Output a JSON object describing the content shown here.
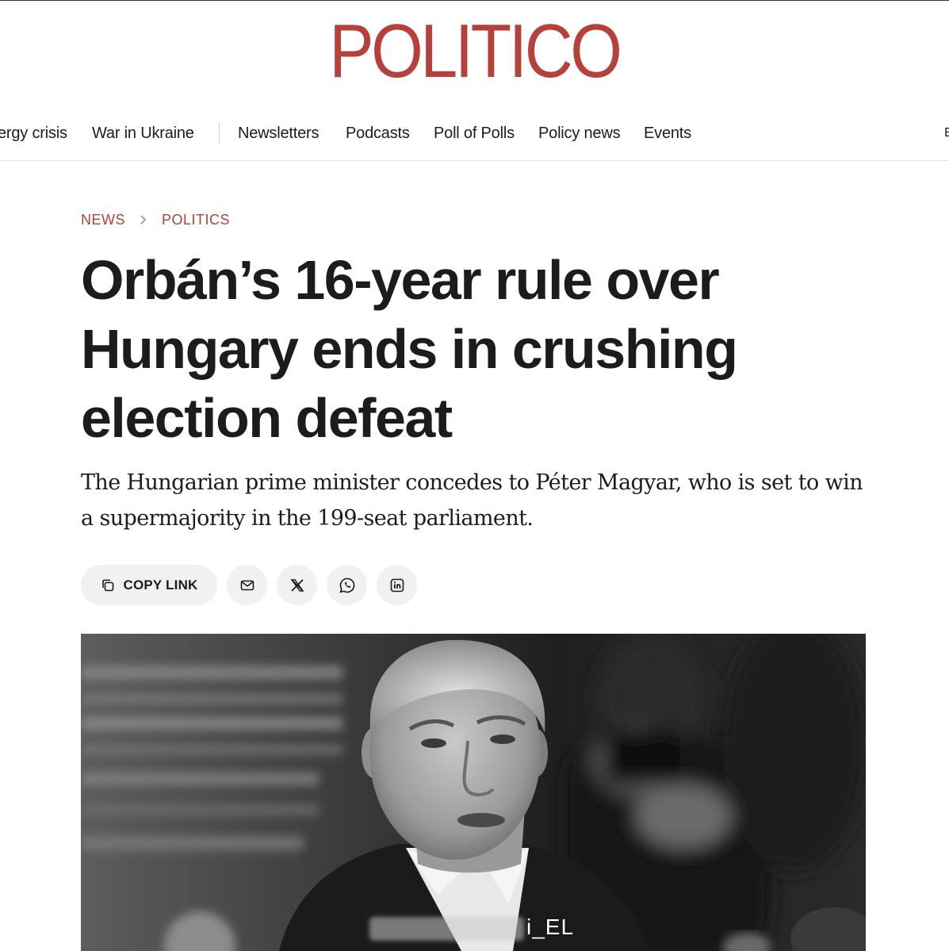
{
  "brand": {
    "logo_text": "POLITICO",
    "color": "#b6403a"
  },
  "nav": {
    "items": [
      "ergy crisis",
      "War in Ukraine",
      "Newsletters",
      "Podcasts",
      "Poll of Polls",
      "Policy news",
      "Events"
    ],
    "overflow_glyph": "E"
  },
  "breadcrumb": {
    "section": "NEWS",
    "subsection": "POLITICS",
    "separator_icon": "chevron-right-icon"
  },
  "article": {
    "headline": "Orbán’s 16-year rule over Hungary ends in crushing election defeat",
    "dek": "The Hungarian prime minister concedes to Péter Magyar, who is set to win a supermajority in the 199-seat parliament."
  },
  "share": {
    "copy_label": "COPY LINK",
    "icons": [
      "copy-icon",
      "mail-icon",
      "x-icon",
      "whatsapp-icon",
      "linkedin-icon"
    ]
  },
  "hero_image": {
    "watermark_text": "i_EL"
  }
}
